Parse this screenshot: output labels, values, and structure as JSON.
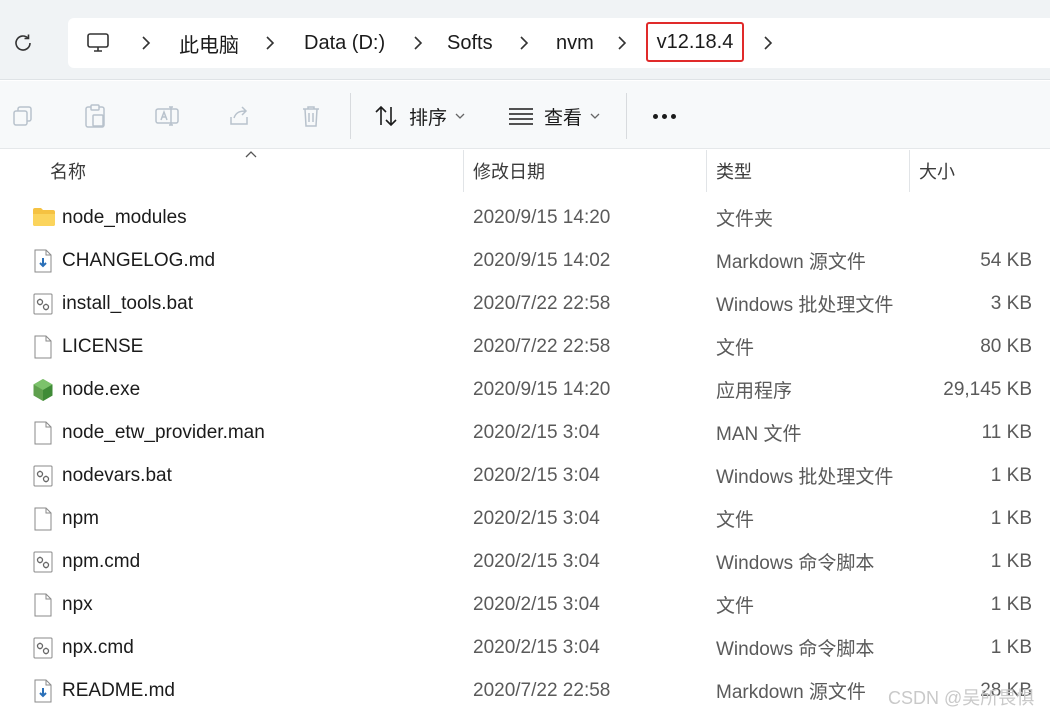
{
  "breadcrumb": {
    "items": [
      "此电脑",
      "Data (D:)",
      "Softs",
      "nvm"
    ],
    "current": "v12.18.4"
  },
  "toolbar": {
    "sort_label": "排序",
    "view_label": "查看"
  },
  "columns": {
    "name": "名称",
    "date": "修改日期",
    "type": "类型",
    "size": "大小"
  },
  "files": [
    {
      "name": "node_modules",
      "date": "2020/9/15 14:20",
      "type": "文件夹",
      "size": "",
      "icon": "folder-icon"
    },
    {
      "name": "CHANGELOG.md",
      "date": "2020/9/15 14:02",
      "type": "Markdown 源文件",
      "size": "54 KB",
      "icon": "markdown-file-icon"
    },
    {
      "name": "install_tools.bat",
      "date": "2020/7/22 22:58",
      "type": "Windows 批处理文件",
      "size": "3 KB",
      "icon": "batch-file-icon"
    },
    {
      "name": "LICENSE",
      "date": "2020/7/22 22:58",
      "type": "文件",
      "size": "80 KB",
      "icon": "file-icon"
    },
    {
      "name": "node.exe",
      "date": "2020/9/15 14:20",
      "type": "应用程序",
      "size": "29,145 KB",
      "icon": "nodejs-icon"
    },
    {
      "name": "node_etw_provider.man",
      "date": "2020/2/15 3:04",
      "type": "MAN 文件",
      "size": "11 KB",
      "icon": "file-icon"
    },
    {
      "name": "nodevars.bat",
      "date": "2020/2/15 3:04",
      "type": "Windows 批处理文件",
      "size": "1 KB",
      "icon": "batch-file-icon"
    },
    {
      "name": "npm",
      "date": "2020/2/15 3:04",
      "type": "文件",
      "size": "1 KB",
      "icon": "file-icon"
    },
    {
      "name": "npm.cmd",
      "date": "2020/2/15 3:04",
      "type": "Windows 命令脚本",
      "size": "1 KB",
      "icon": "batch-file-icon"
    },
    {
      "name": "npx",
      "date": "2020/2/15 3:04",
      "type": "文件",
      "size": "1 KB",
      "icon": "file-icon"
    },
    {
      "name": "npx.cmd",
      "date": "2020/2/15 3:04",
      "type": "Windows 命令脚本",
      "size": "1 KB",
      "icon": "batch-file-icon"
    },
    {
      "name": "README.md",
      "date": "2020/7/22 22:58",
      "type": "Markdown 源文件",
      "size": "28 KB",
      "icon": "markdown-file-icon"
    }
  ],
  "watermark": "CSDN @吴所畏惧",
  "colors": {
    "highlight_border": "#e02a2a",
    "folder": "#f5c242",
    "nodejs": "#5fa04e",
    "markdown_arrow": "#2a6fb8"
  }
}
